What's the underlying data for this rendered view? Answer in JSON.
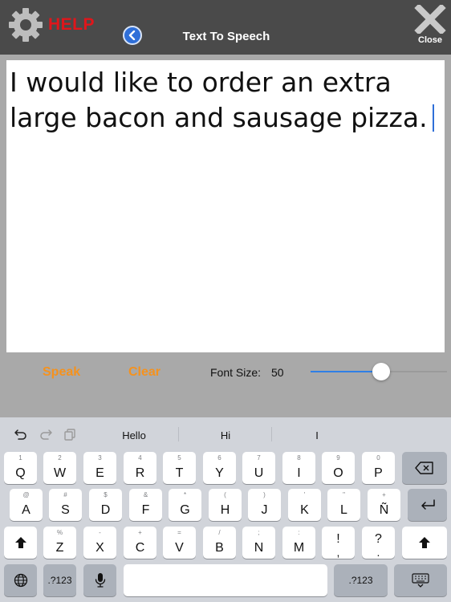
{
  "header": {
    "help_label": "HELP",
    "title": "Text To Speech",
    "close_label": "Close"
  },
  "editor": {
    "text": "I would like to order an extra large bacon and sausage pizza."
  },
  "controls": {
    "speak_label": "Speak",
    "clear_label": "Clear",
    "font_size_label": "Font Size:",
    "font_size_value": "50",
    "slider_level": 0.52
  },
  "keyboard": {
    "suggestions": [
      "Hello",
      "Hi",
      "I"
    ],
    "row1": [
      {
        "main": "Q",
        "alt": "1"
      },
      {
        "main": "W",
        "alt": "2"
      },
      {
        "main": "E",
        "alt": "3"
      },
      {
        "main": "R",
        "alt": "4"
      },
      {
        "main": "T",
        "alt": "5"
      },
      {
        "main": "Y",
        "alt": "6"
      },
      {
        "main": "U",
        "alt": "7"
      },
      {
        "main": "I",
        "alt": "8"
      },
      {
        "main": "O",
        "alt": "9"
      },
      {
        "main": "P",
        "alt": "0"
      }
    ],
    "row2": [
      {
        "main": "A",
        "alt": "@"
      },
      {
        "main": "S",
        "alt": "#"
      },
      {
        "main": "D",
        "alt": "$"
      },
      {
        "main": "F",
        "alt": "&"
      },
      {
        "main": "G",
        "alt": "*"
      },
      {
        "main": "H",
        "alt": "("
      },
      {
        "main": "J",
        "alt": ")"
      },
      {
        "main": "K",
        "alt": "'"
      },
      {
        "main": "L",
        "alt": "\""
      },
      {
        "main": "Ñ",
        "alt": "+"
      }
    ],
    "row3": [
      {
        "main": "Z",
        "alt": "%"
      },
      {
        "main": "X",
        "alt": "-"
      },
      {
        "main": "C",
        "alt": "+"
      },
      {
        "main": "V",
        "alt": "="
      },
      {
        "main": "B",
        "alt": "/"
      },
      {
        "main": "N",
        "alt": ";"
      },
      {
        "main": "M",
        "alt": ":"
      },
      {
        "main": "!",
        "alt": ","
      },
      {
        "main": "?",
        "alt": "."
      }
    ],
    "numbers_label": ".?123"
  },
  "icons": {
    "settings": "gear-icon",
    "back": "chevron-left-icon",
    "close": "x-icon",
    "undo": "undo-icon",
    "redo": "redo-icon",
    "paste": "paste-icon",
    "delete": "backspace-icon",
    "return": "return-icon",
    "shift": "shift-icon",
    "globe": "globe-icon",
    "mic": "microphone-icon",
    "hide_keyboard": "keyboard-hide-icon"
  },
  "colors": {
    "header_bg": "#4a4a4a",
    "help_red": "#e0161b",
    "action_orange": "#f5921e",
    "accent_blue": "#2f6fd8"
  }
}
